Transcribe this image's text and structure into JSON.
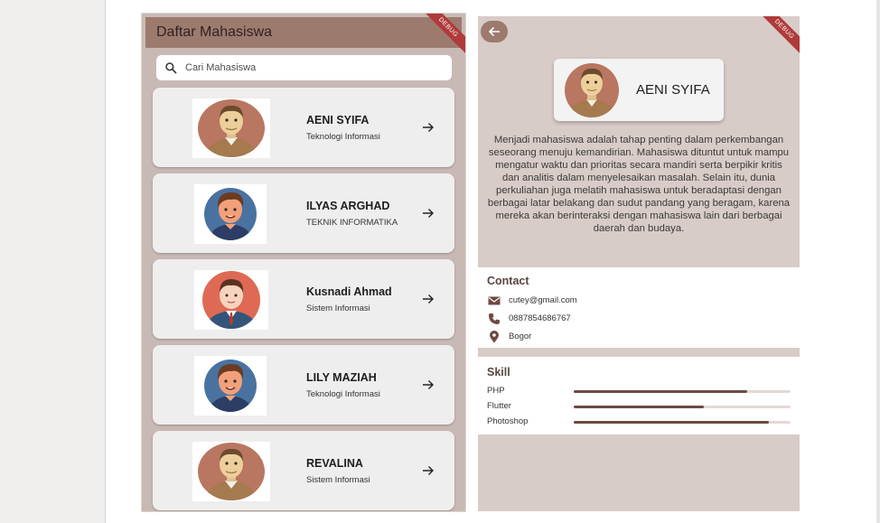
{
  "left": {
    "title": "Daftar Mahasiswa",
    "debug_banner": "DEBUG",
    "search_placeholder": "Cari Mahasiswa",
    "students": [
      {
        "name": "AENI SYIFA",
        "dept": "Teknologi Informasi",
        "avatar": "man-beard-brown-circle-avatar"
      },
      {
        "name": "ILYAS ARGHAD",
        "dept": "TEKNIK INFORMATIKA",
        "avatar": "man-blue-circle-avatar"
      },
      {
        "name": "Kusnadi Ahmad",
        "dept": "Sistem Informasi",
        "avatar": "man-suit-red-circle-avatar"
      },
      {
        "name": "LILY MAZIAH",
        "dept": "Teknologi Informasi",
        "avatar": "man-blue-circle-avatar"
      },
      {
        "name": "REVALINA",
        "dept": "Sistem Informasi",
        "avatar": "man-beard-brown-circle-avatar"
      }
    ]
  },
  "detail": {
    "debug_banner": "DEBUG",
    "name": "AENI SYIFA",
    "bio": "Menjadi mahasiswa adalah tahap penting dalam perkembangan seseorang menuju kemandirian. Mahasiswa dituntut untuk mampu mengatur waktu dan prioritas secara mandiri serta berpikir kritis dan analitis dalam menyelesaikan masalah. Selain itu, dunia perkuliahan juga melatih mahasiswa untuk beradaptasi dengan berbagai latar belakang dan sudut pandang yang beragam, karena mereka akan berinteraksi dengan mahasiswa lain dari berbagai daerah dan budaya.",
    "contact_title": "Contact",
    "contacts": [
      {
        "icon": "mail-icon",
        "text": "cutey@gmail.com"
      },
      {
        "icon": "phone-icon",
        "text": "0887854686767"
      },
      {
        "icon": "location-pin-icon",
        "text": "Bogor"
      }
    ],
    "skill_title": "Skill",
    "skills": [
      {
        "name": "PHP",
        "level": 0.8
      },
      {
        "name": "Flutter",
        "level": 0.6
      },
      {
        "name": "Photoshop",
        "level": 0.9
      }
    ]
  },
  "colors": {
    "appbar": "#9d7a6e",
    "panel_bg": "#d8ccc8",
    "skill_fill": "#6c4a42",
    "debug": "#b03a3a"
  }
}
